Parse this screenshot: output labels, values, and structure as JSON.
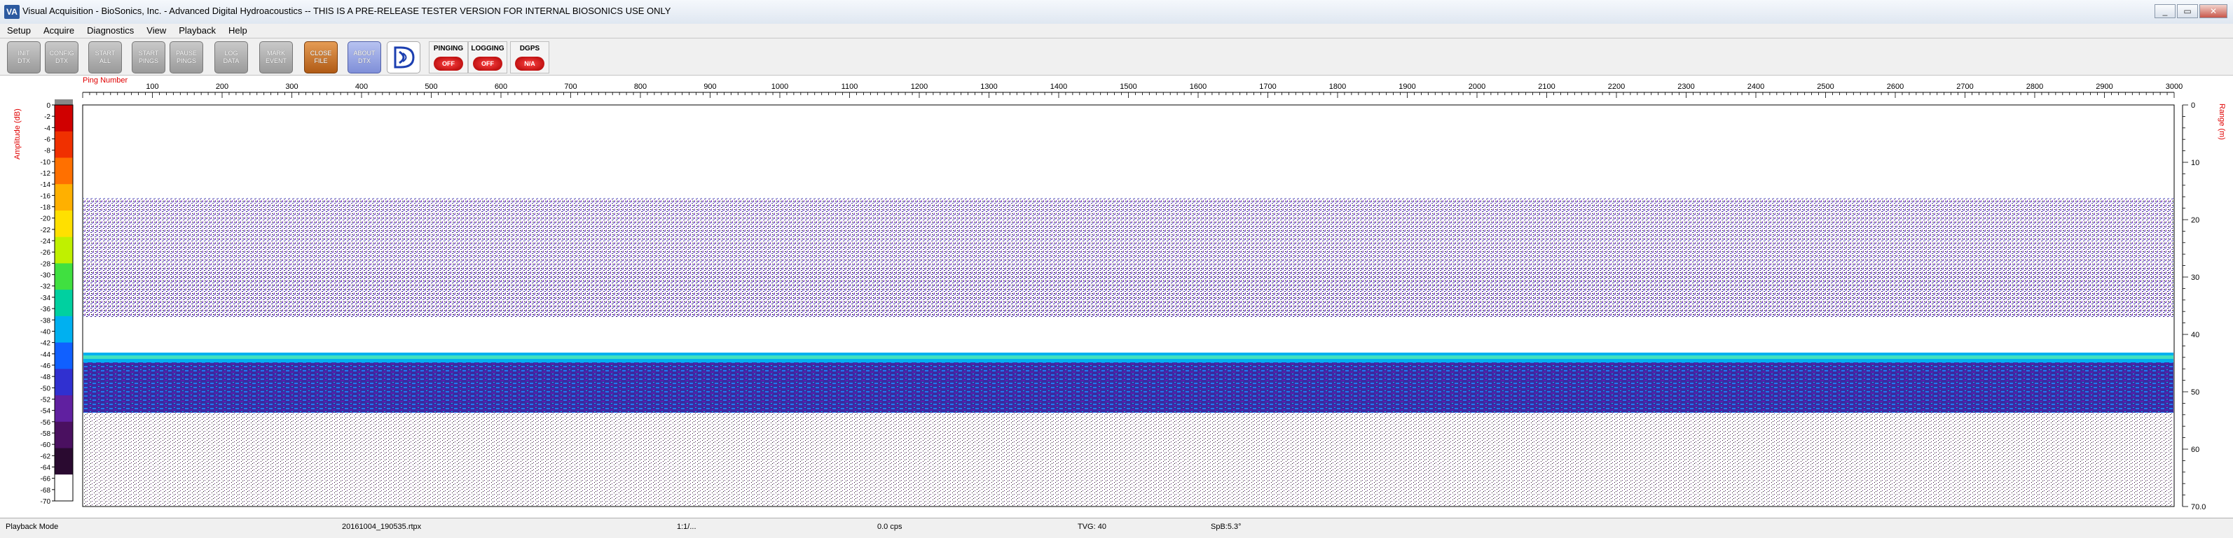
{
  "window": {
    "title": "Visual Acquisition  -  BioSonics, Inc.  -  Advanced Digital Hydroacoustics  -- THIS IS A PRE-RELEASE TESTER VERSION FOR INTERNAL BIOSONICS USE ONLY",
    "icon_label": "VA"
  },
  "menu": [
    "Setup",
    "Acquire",
    "Diagnostics",
    "View",
    "Playback",
    "Help"
  ],
  "toolbar": {
    "buttons": [
      {
        "label": "INIT\nDTX",
        "icon": "init-dtx"
      },
      {
        "label": "CONFIG\nDTX",
        "icon": "config-dtx"
      },
      {
        "label": "START\nALL",
        "icon": "start-all"
      },
      {
        "label": "START\nPINGS",
        "icon": "start-pings"
      },
      {
        "label": "PAUSE\nPINGS",
        "icon": "pause-pings"
      },
      {
        "label": "LOG\nDATA",
        "icon": "log-data"
      },
      {
        "label": "MARK\nEVENT",
        "icon": "mark-event"
      },
      {
        "label": "CLOSE\nFILE",
        "icon": "close-file"
      },
      {
        "label": "ABOUT\nDTX",
        "icon": "about-dtx"
      }
    ],
    "status": [
      {
        "label": "PINGING",
        "value": "OFF"
      },
      {
        "label": "LOGGING",
        "value": "OFF"
      },
      {
        "label": "DGPS",
        "value": "N/A"
      }
    ]
  },
  "echogram": {
    "x_axis_label": "Ping Number",
    "x_ticks": [
      100,
      200,
      300,
      400,
      500,
      600,
      700,
      800,
      900,
      1000,
      1100,
      1200,
      1300,
      1400,
      1500,
      1600,
      1700,
      1800,
      1900,
      2000,
      2100,
      2200,
      2300,
      2400,
      2500,
      2600,
      2700,
      2800,
      2900,
      3000
    ],
    "y_left_label": "Amplitude (dB)",
    "y_right_label": "Range (m)",
    "range_ticks": [
      "0",
      "10",
      "20",
      "30",
      "40",
      "50",
      "60",
      "70.0"
    ],
    "amplitude_ticks": [
      "0",
      "-2",
      "-4",
      "-6",
      "-8",
      "-10",
      "-12",
      "-14",
      "-16",
      "-18",
      "-20",
      "-22",
      "-24",
      "-26",
      "-28",
      "-30",
      "-32",
      "-34",
      "-36",
      "-38",
      "-40",
      "-42",
      "-44",
      "-46",
      "-48",
      "-50",
      "-52",
      "-54",
      "-56",
      "-58",
      "-60",
      "-62",
      "-64",
      "-66",
      "-68",
      "-70"
    ],
    "colorbar": [
      "#d00000",
      "#f03000",
      "#ff7000",
      "#ffb000",
      "#ffe000",
      "#c0f000",
      "#40e040",
      "#00d0a0",
      "#00b0f0",
      "#1060ff",
      "#3030d0",
      "#6020a0",
      "#4a1060",
      "#2a0a30",
      "#ffffff"
    ]
  },
  "statusbar": {
    "mode": "Playback Mode",
    "file": "20161004_190535.rtpx",
    "ratio": "1:1/...",
    "rate": "0.0 cps",
    "tvg": "TVG: 40",
    "spb": "SpB:5.3°"
  }
}
